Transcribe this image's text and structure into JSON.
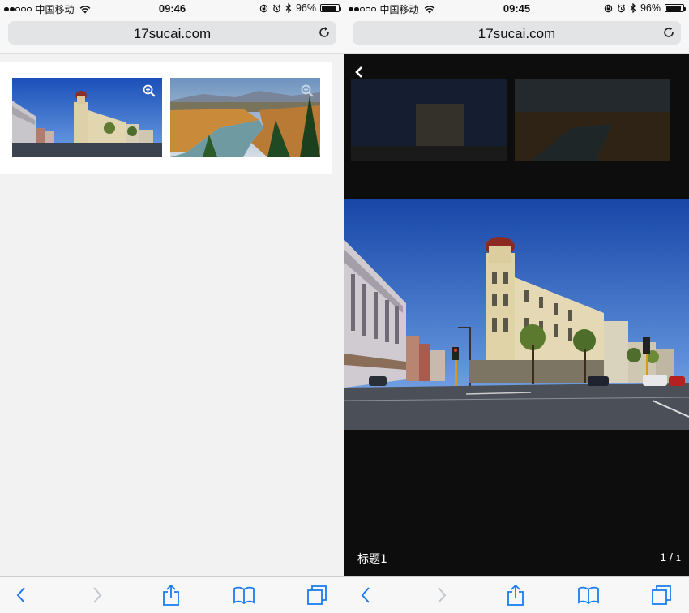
{
  "left": {
    "status": {
      "signal": "full-full-empty-empty-empty",
      "carrier": "中国移动",
      "time": "09:46",
      "battery": "96%"
    },
    "url": "17sucai.com",
    "thumbnails": [
      {
        "subject": "street corner building under blue sky",
        "icon": "zoom-in-icon"
      },
      {
        "subject": "river valley with autumn trees",
        "icon": "zoom-in-icon"
      }
    ]
  },
  "right": {
    "status": {
      "carrier": "中国移动",
      "time": "09:45",
      "battery": "96%"
    },
    "url": "17sucai.com",
    "caption": "标题1",
    "counter": {
      "current": "1",
      "separator": "/",
      "total": "1"
    }
  },
  "toolbar_icons": [
    "back-icon",
    "forward-icon",
    "share-icon",
    "bookmarks-icon",
    "tabs-icon"
  ],
  "colors": {
    "accent": "#1a7bf2",
    "disabled": "#c3c7cc",
    "lightbox_bg": "#0d0d0d",
    "page_bg": "#f2f2f2"
  }
}
